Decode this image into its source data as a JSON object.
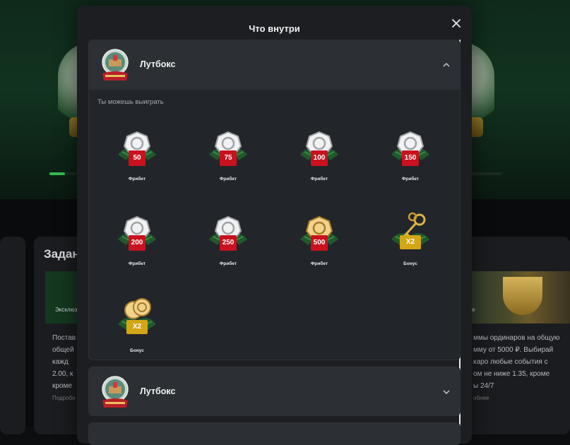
{
  "modal": {
    "title": "Что внутри"
  },
  "sections": [
    {
      "title": "Лутбокс",
      "expanded": true,
      "win_label": "Ты можешь выиграть",
      "prizes": [
        {
          "type": "freebet",
          "value": "50",
          "label": "Фрибет",
          "metal": "silver"
        },
        {
          "type": "freebet",
          "value": "75",
          "label": "Фрибет",
          "metal": "silver"
        },
        {
          "type": "freebet",
          "value": "100",
          "label": "Фрибет",
          "metal": "silver"
        },
        {
          "type": "freebet",
          "value": "150",
          "label": "Фрибет",
          "metal": "silver"
        },
        {
          "type": "freebet",
          "value": "200",
          "label": "Фрибет",
          "metal": "silver"
        },
        {
          "type": "freebet",
          "value": "250",
          "label": "Фрибет",
          "metal": "silver"
        },
        {
          "type": "freebet",
          "value": "500",
          "label": "Фрибет",
          "metal": "gold"
        },
        {
          "type": "bonus-keys",
          "value": "X2",
          "label": "Бонус",
          "metal": "gold"
        },
        {
          "type": "bonus-coins",
          "value": "X2",
          "label": "Бонус",
          "metal": "gold"
        }
      ]
    },
    {
      "title": "Лутбокс",
      "expanded": false
    }
  ],
  "background": {
    "section_title": "Задан",
    "card_lines_left": [
      "Постав",
      "общей",
      "кажд",
      "2.00, к",
      "кроме"
    ],
    "card_sub_left": "Подробн",
    "tile_text_left": "Эксклюзив",
    "card_lines_right": [
      "ммы ординаров на общую",
      "мму от 5000 ₽. Выбирай",
      "каро любые события с",
      "ом не ниже 1.35, кроме",
      "ы 24/7"
    ],
    "card_sub_right": "обнее",
    "tile_text_right": "ве"
  },
  "colors": {
    "modal_bg": "#1c1e21",
    "header_bg": "#2c2f33",
    "freebet_badge": "#c8121e",
    "bonus_badge": "#d4a516",
    "progress_green": "#2fbf4f"
  },
  "icons": {
    "close": "close-icon",
    "chevron_up": "chevron-up-icon",
    "chevron_down": "chevron-down-icon",
    "lootbox": "snow-globe-icon"
  }
}
